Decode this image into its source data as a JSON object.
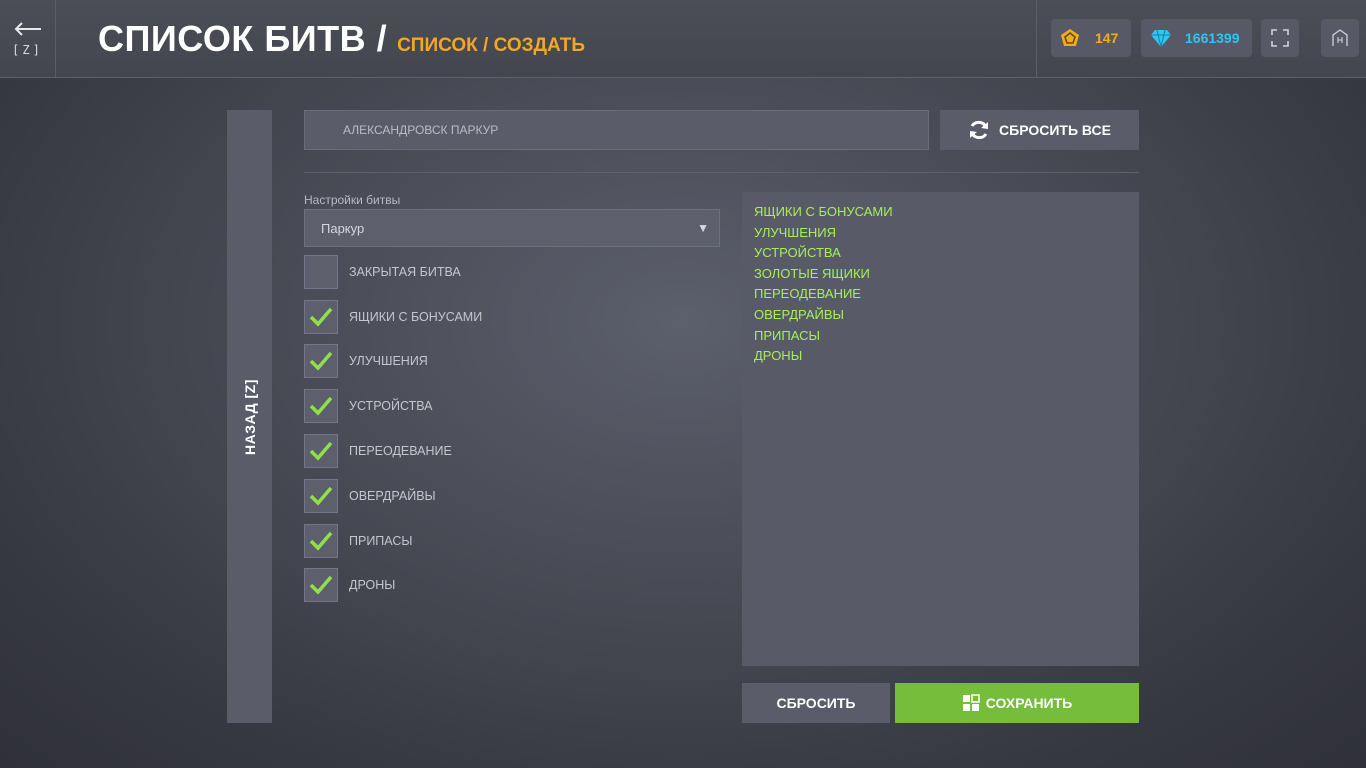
{
  "header": {
    "back_hotkey": "[Z]",
    "title": "СПИСОК БИТВ /",
    "subtitle": "СПИСОК / СОЗДАТЬ",
    "crystals_gold": "147",
    "crystals_blue": "1661399",
    "colors": {
      "gold": "#f0ad1a",
      "gem": "#2ec6f2",
      "accent": "#f5a623"
    }
  },
  "side": {
    "back_label": "НАЗАД [Z]"
  },
  "form": {
    "name_value": "АЛЕКСАНДРОВСК ПАРКУР",
    "reset_all_label": "СБРОСИТЬ ВСЕ",
    "settings_label": "Настройки битвы",
    "mode_value": "Паркур",
    "options": [
      {
        "label": "ЗАКРЫТАЯ БИТВА",
        "checked": false
      },
      {
        "label": "ЯЩИКИ С БОНУСАМИ",
        "checked": true
      },
      {
        "label": "УЛУЧШЕНИЯ",
        "checked": true
      },
      {
        "label": "УСТРОЙСТВА",
        "checked": true
      },
      {
        "label": "ПЕРЕОДЕВАНИЕ",
        "checked": true
      },
      {
        "label": "ОВЕРДРАЙВЫ",
        "checked": true
      },
      {
        "label": "ПРИПАСЫ",
        "checked": true
      },
      {
        "label": "ДРОНЫ",
        "checked": true
      }
    ]
  },
  "summary": {
    "items": [
      "ЯЩИКИ С БОНУСАМИ",
      "УЛУЧШЕНИЯ",
      "УСТРОЙСТВА",
      "ЗОЛОТЫЕ ЯЩИКИ",
      "ПЕРЕОДЕВАНИЕ",
      "ОВЕРДРАЙВЫ",
      "ПРИПАСЫ",
      "ДРОНЫ"
    ],
    "text_color": "#a4f05a"
  },
  "actions": {
    "reset_label": "СБРОСИТЬ",
    "save_label": "СОХРАНИТЬ",
    "save_color": "#76bd3c"
  }
}
